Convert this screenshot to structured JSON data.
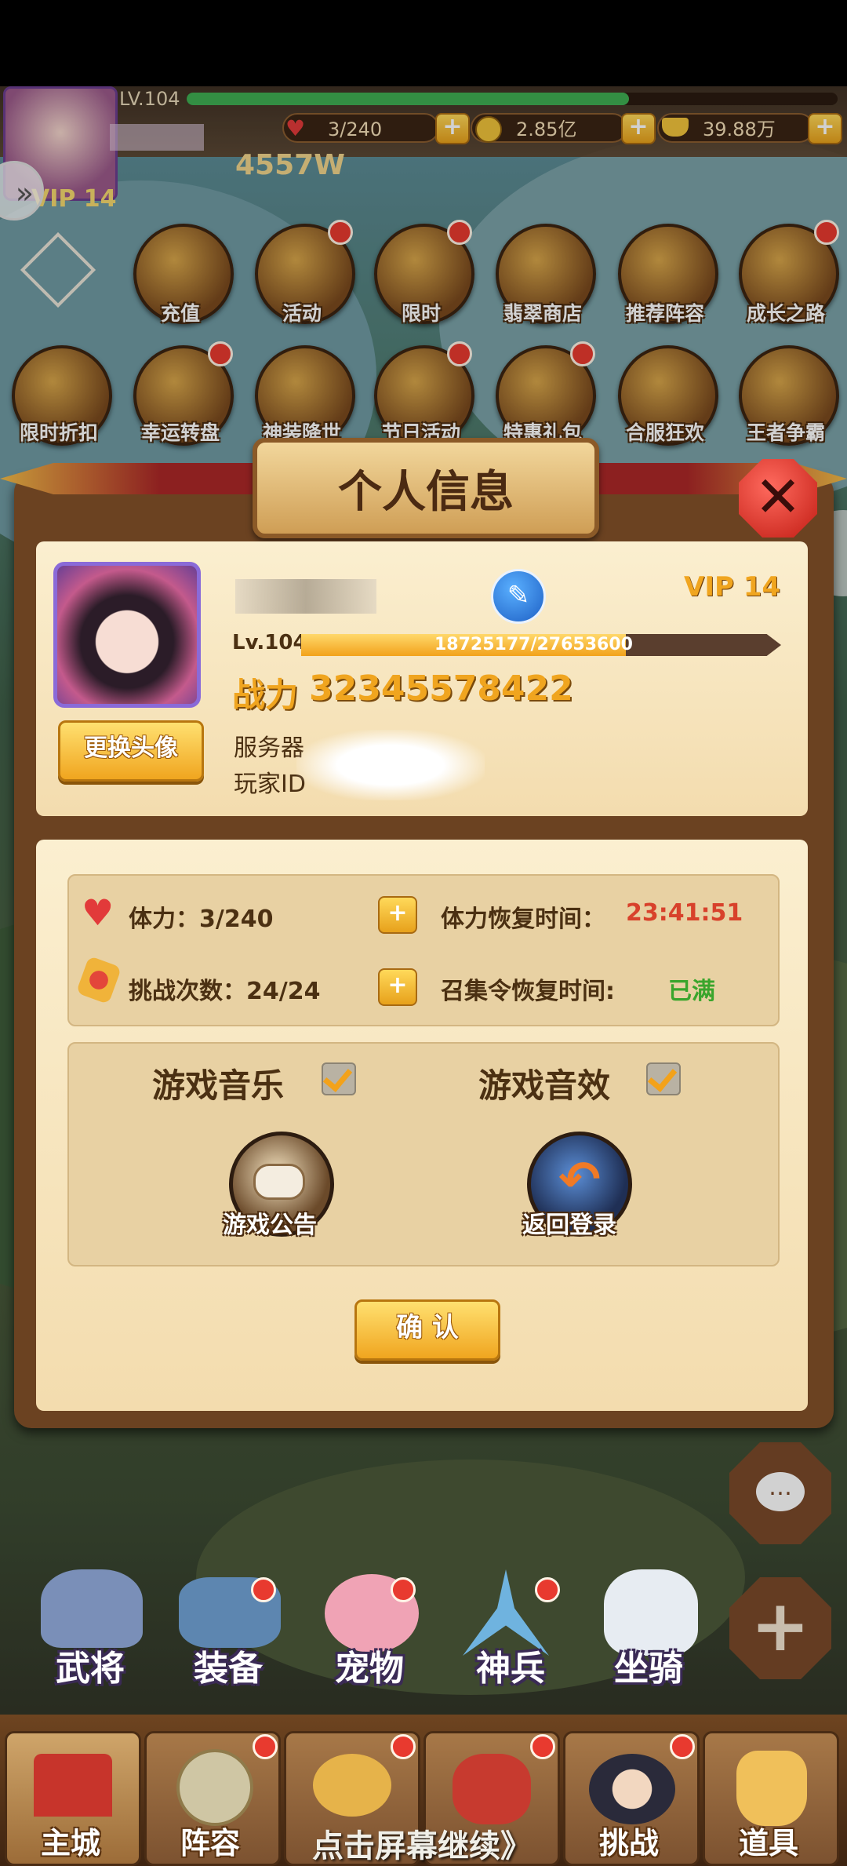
{
  "top": {
    "level": "LV.104",
    "power_partial": "4557W",
    "vip": "VIP 14",
    "stamina": "3/240",
    "coins": "2.85亿",
    "ingots": "39.88万"
  },
  "menu_row1": [
    "充值",
    "活动",
    "限时",
    "翡翠商店",
    "推荐阵容",
    "成长之路"
  ],
  "menu_row2": [
    "限时折扣",
    "幸运转盘",
    "神装降世",
    "节日活动",
    "特惠礼包",
    "合服狂欢",
    "王者争霸"
  ],
  "dialog": {
    "title": "个人信息",
    "vip": "VIP 14",
    "level": "Lv.104",
    "exp": "18725177/27653600",
    "exp_fraction": 0.677,
    "power_label": "战力",
    "power_value": "32345578422",
    "change_avatar": "更换头像",
    "server_label": "服务器",
    "player_id_label": "玩家ID",
    "stamina_label": "体力：3/240",
    "stamina_recover_label": "体力恢复时间：",
    "stamina_recover_value": "23:41:51",
    "challenge_label": "挑战次数：24/24",
    "summon_recover_label": "召集令恢复时间:",
    "summon_recover_value": "已满",
    "music_label": "游戏音乐",
    "sfx_label": "游戏音效",
    "announcement_label": "游戏公告",
    "back_login_label": "返回登录",
    "confirm_label": "确 认"
  },
  "features": [
    "武将",
    "装备",
    "宠物",
    "神兵",
    "坐骑"
  ],
  "tabs": [
    "主城",
    "阵容",
    "",
    "",
    "挑战",
    "道具"
  ],
  "continue_hint": "点击屏幕继续》",
  "colors": {
    "recover_time": "#d8412b",
    "full_status": "#3aa52c",
    "power": "#f0a51f",
    "exp_fill": "#f6b93a"
  }
}
